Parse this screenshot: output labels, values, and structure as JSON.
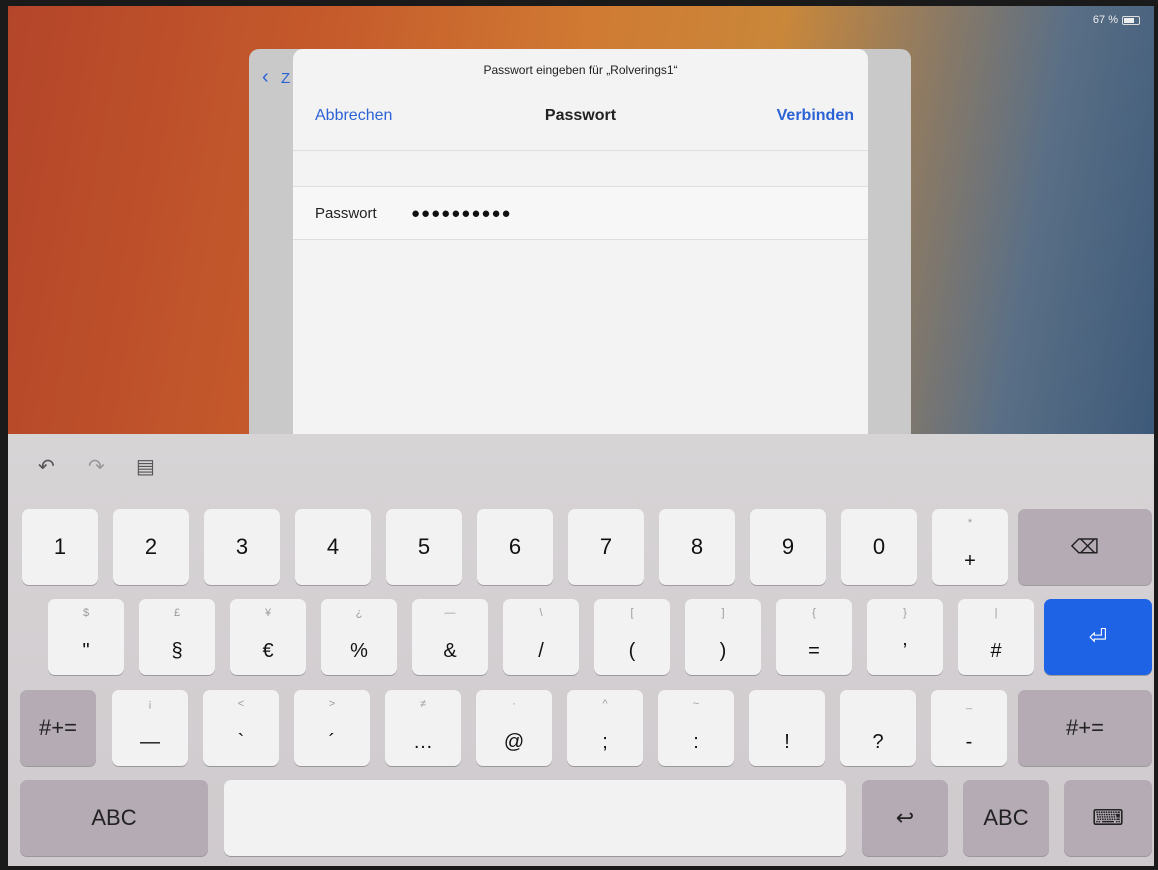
{
  "status": {
    "battery_text": "67 %"
  },
  "dialog": {
    "back_letter": "Z",
    "prompt": "Passwort eingeben für „Rolverings1“",
    "cancel_label": "Abbrechen",
    "title": "Passwort",
    "connect_label": "Verbinden",
    "password_label": "Passwort",
    "password_value": "●●●●●●●●●●"
  },
  "keyboard": {
    "toolbar": {
      "undo": "↶",
      "redo": "↷",
      "paste": "▤"
    },
    "row1": [
      {
        "main": "1"
      },
      {
        "main": "2"
      },
      {
        "main": "3"
      },
      {
        "main": "4"
      },
      {
        "main": "5"
      },
      {
        "main": "6"
      },
      {
        "main": "7"
      },
      {
        "main": "8"
      },
      {
        "main": "9"
      },
      {
        "main": "0"
      },
      {
        "alt": "*",
        "main": "+"
      }
    ],
    "delete_label": "⌫",
    "row2": [
      {
        "alt": "$",
        "main": "\""
      },
      {
        "alt": "£",
        "main": "§"
      },
      {
        "alt": "¥",
        "main": "€"
      },
      {
        "alt": "¿",
        "main": "%"
      },
      {
        "alt": "—",
        "main": "&"
      },
      {
        "alt": "\\",
        "main": "/"
      },
      {
        "alt": "[",
        "main": "("
      },
      {
        "alt": "]",
        "main": ")"
      },
      {
        "alt": "{",
        "main": "="
      },
      {
        "alt": "}",
        "main": "’"
      },
      {
        "alt": "|",
        "main": "#"
      }
    ],
    "return_label": "⏎",
    "symbols_left": "#+=",
    "row3": [
      {
        "alt": "¡",
        "main": "—"
      },
      {
        "alt": "<",
        "main": "`"
      },
      {
        "alt": ">",
        "main": "´"
      },
      {
        "alt": "≠",
        "main": "…"
      },
      {
        "alt": "·",
        "main": "@"
      },
      {
        "alt": "^",
        "main": ";"
      },
      {
        "alt": "~",
        "main": ":"
      },
      {
        "alt": "",
        "main": "!"
      },
      {
        "alt": "",
        "main": "?"
      },
      {
        "alt": "_",
        "main": "-"
      }
    ],
    "row3_sub": [
      "",
      "",
      "",
      "",
      "",
      "",
      "",
      ",",
      ".",
      ""
    ],
    "symbols_right": "#+=",
    "abc_left": "ABC",
    "undo_key": "↩",
    "abc_right": "ABC",
    "hide_keyboard": "⌨"
  }
}
